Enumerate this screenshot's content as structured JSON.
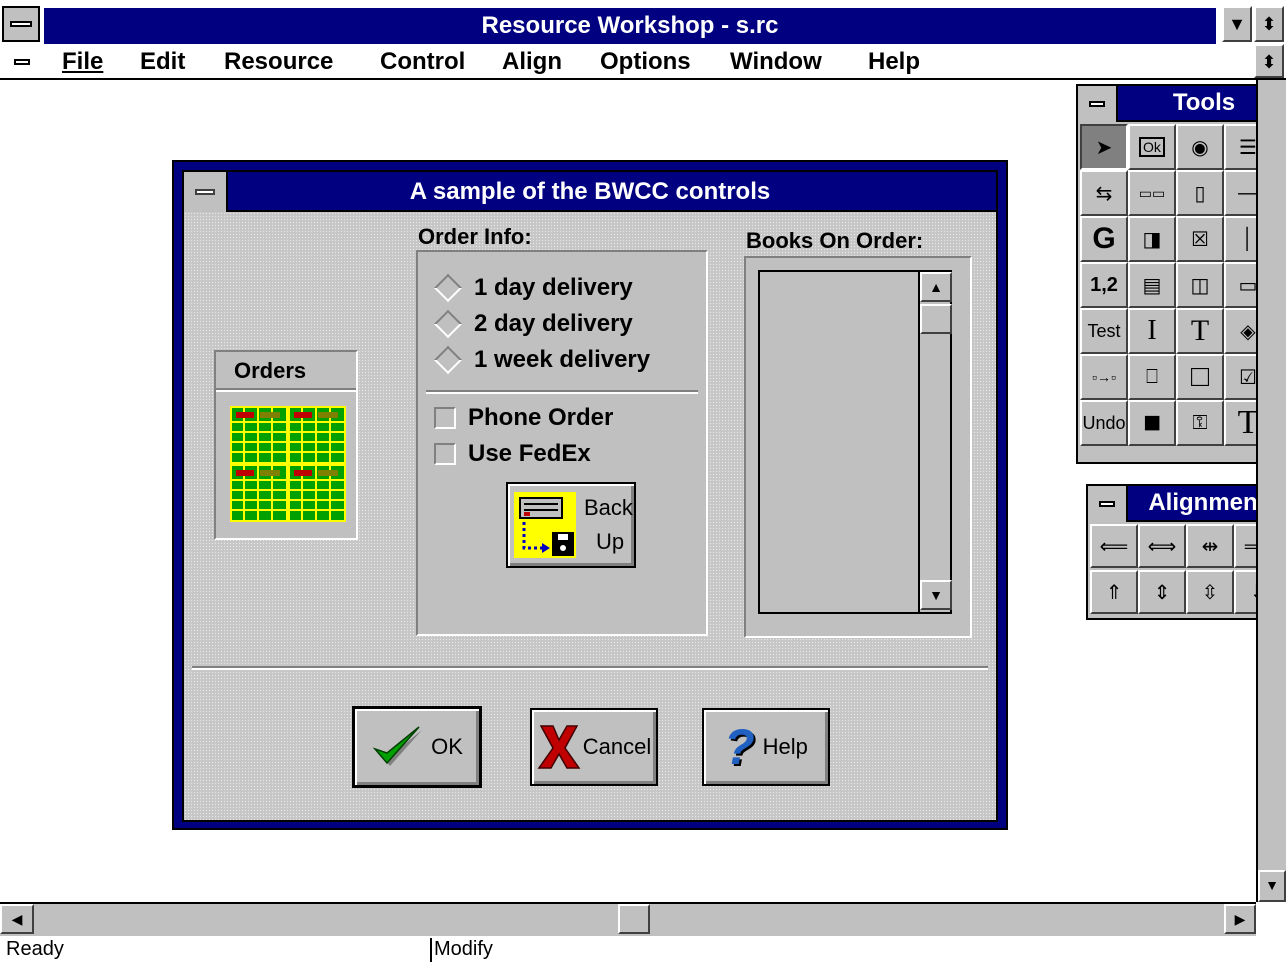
{
  "window": {
    "title": "Resource Workshop - s.rc"
  },
  "menu": {
    "items": [
      "File",
      "Edit",
      "Resource",
      "Control",
      "Align",
      "Options",
      "Window",
      "Help"
    ]
  },
  "dialog": {
    "title": "A sample of the BWCC controls",
    "orders_label": "Orders",
    "order_info": {
      "label": "Order Info:",
      "radios": [
        "1 day delivery",
        "2 day delivery",
        "1 week delivery"
      ],
      "checks": [
        "Phone Order",
        "Use FedEx"
      ]
    },
    "backup_button": {
      "line1": "Back",
      "line2": "Up"
    },
    "books_label": "Books On Order:",
    "buttons": {
      "ok": "OK",
      "cancel": "Cancel",
      "help": "Help"
    }
  },
  "tools_palette": {
    "title": "Tools",
    "text_tools": {
      "numbering": "1,2",
      "test": "Test",
      "undo": "Undo",
      "ok": "Ok"
    }
  },
  "alignment_palette": {
    "title": "Alignment"
  },
  "statusbar": {
    "left": "Ready",
    "right": "Modify"
  },
  "colors": {
    "titlebar": "#000080",
    "face": "#c0c0c0",
    "ok_check": "#008000",
    "cancel_x": "#c00000",
    "help_q": "#2060c0"
  }
}
